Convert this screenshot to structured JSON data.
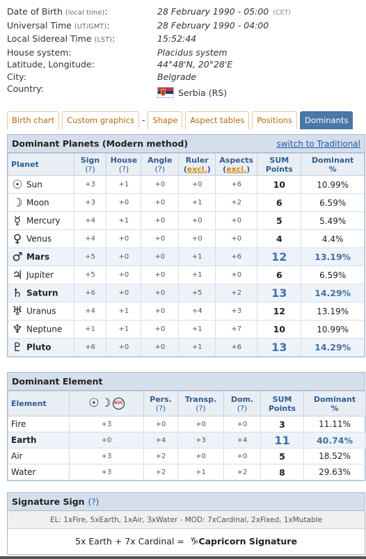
{
  "info": [
    {
      "label": "Date of Birth",
      "hint": "(local time)",
      "value": "28 February 1990 - 05:00",
      "extra": "(CET)"
    },
    {
      "label": "Universal Time",
      "hint": "(UT/GMT)",
      "value": "28 February 1990 - 04:00",
      "extra": ""
    },
    {
      "label": "Local Sidereal Time",
      "hint": "(LST)",
      "value": "15:52:44",
      "extra": ""
    },
    {
      "label": "House system:",
      "hint": "",
      "value": "Placidus system",
      "extra": ""
    },
    {
      "label": "Latitude, Longitude:",
      "hint": "",
      "value": "44°48'N, 20°28'E",
      "extra": ""
    },
    {
      "label": "City:",
      "hint": "",
      "value": "Belgrade",
      "extra": ""
    },
    {
      "label": "Country:",
      "hint": "",
      "value": "Serbia (RS)",
      "extra": ""
    }
  ],
  "tabs": [
    "Birth chart",
    "Custom graphics",
    "-",
    "Shape",
    "Aspect tables",
    "Positions",
    "Dominants"
  ],
  "active_tab": "Dominants",
  "planets_box": {
    "title": "Dominant Planets (Modern method)",
    "link": "switch to Traditional",
    "headers": {
      "planet": "Planet",
      "sign": "Sign",
      "house": "House",
      "angle": "Angle",
      "ruler": "Ruler",
      "aspects": "Aspects",
      "q": "(?)",
      "excl": "excl.",
      "sum1": "SUM",
      "sum2": "Points",
      "dom1": "Dominant",
      "dom2": "%"
    },
    "rows": [
      {
        "icon": "sun-icon",
        "glyph": "☉",
        "name": "Sun",
        "sign": "+3",
        "house": "+1",
        "angle": "+0",
        "ruler": "+0",
        "aspects": "+6",
        "sum": "10",
        "dom": "10.99%",
        "hl": false
      },
      {
        "icon": "moon-icon",
        "glyph": "☽",
        "name": "Moon",
        "sign": "+3",
        "house": "+0",
        "angle": "+0",
        "ruler": "+1",
        "aspects": "+2",
        "sum": "6",
        "dom": "6.59%",
        "hl": false
      },
      {
        "icon": "mercury-icon",
        "glyph": "☿",
        "name": "Mercury",
        "sign": "+4",
        "house": "+1",
        "angle": "+0",
        "ruler": "+0",
        "aspects": "+0",
        "sum": "5",
        "dom": "5.49%",
        "hl": false
      },
      {
        "icon": "venus-icon",
        "glyph": "♀",
        "name": "Venus",
        "sign": "+4",
        "house": "+0",
        "angle": "+0",
        "ruler": "+0",
        "aspects": "+0",
        "sum": "4",
        "dom": "4.4%",
        "hl": false
      },
      {
        "icon": "mars-icon",
        "glyph": "♂",
        "name": "Mars",
        "sign": "+5",
        "house": "+0",
        "angle": "+0",
        "ruler": "+1",
        "aspects": "+6",
        "sum": "12",
        "dom": "13.19%",
        "hl": true
      },
      {
        "icon": "jupiter-icon",
        "glyph": "♃",
        "name": "Jupiter",
        "sign": "+5",
        "house": "+0",
        "angle": "+0",
        "ruler": "+1",
        "aspects": "+0",
        "sum": "6",
        "dom": "6.59%",
        "hl": false
      },
      {
        "icon": "saturn-icon",
        "glyph": "♄",
        "name": "Saturn",
        "sign": "+6",
        "house": "+0",
        "angle": "+0",
        "ruler": "+5",
        "aspects": "+2",
        "sum": "13",
        "dom": "14.29%",
        "hl": true
      },
      {
        "icon": "uranus-icon",
        "glyph": "♅",
        "name": "Uranus",
        "sign": "+4",
        "house": "+1",
        "angle": "+0",
        "ruler": "+4",
        "aspects": "+3",
        "sum": "12",
        "dom": "13.19%",
        "hl": false
      },
      {
        "icon": "neptune-icon",
        "glyph": "♆",
        "name": "Neptune",
        "sign": "+1",
        "house": "+1",
        "angle": "+0",
        "ruler": "+1",
        "aspects": "+7",
        "sum": "10",
        "dom": "10.99%",
        "hl": false
      },
      {
        "icon": "pluto-icon",
        "glyph": "♇",
        "name": "Pluto",
        "sign": "+6",
        "house": "+0",
        "angle": "+0",
        "ruler": "+1",
        "aspects": "+6",
        "sum": "13",
        "dom": "14.29%",
        "hl": true
      }
    ]
  },
  "element_box": {
    "title": "Dominant Element",
    "headers": {
      "element": "Element",
      "pers": "Pers.",
      "transp": "Transp.",
      "dom_short": "Dom.",
      "q": "(?)",
      "sum1": "SUM",
      "sum2": "Points",
      "dom1": "Dominant",
      "dom2": "%",
      "asc": "ASC"
    },
    "rows": [
      {
        "name": "Fire",
        "scm": "+3",
        "pers": "+0",
        "transp": "+0",
        "dom_pts": "+0",
        "sum": "3",
        "dom": "11.11%",
        "hl": false
      },
      {
        "name": "Earth",
        "scm": "+0",
        "pers": "+4",
        "transp": "+3",
        "dom_pts": "+4",
        "sum": "11",
        "dom": "40.74%",
        "hl": true
      },
      {
        "name": "Air",
        "scm": "+3",
        "pers": "+2",
        "transp": "+0",
        "dom_pts": "+0",
        "sum": "5",
        "dom": "18.52%",
        "hl": false
      },
      {
        "name": "Water",
        "scm": "+3",
        "pers": "+2",
        "transp": "+1",
        "dom_pts": "+2",
        "sum": "8",
        "dom": "29.63%",
        "hl": false
      }
    ]
  },
  "signature_box": {
    "title": "Signature Sign",
    "q": "(?)",
    "summary": "EL: 1xFire, 5xEarth, 1xAir, 3xWater -  MOD: 7xCardinal, 2xFixed, 1xMutable",
    "formula": "5x Earth + 7x Cardinal =",
    "capricorn_glyph": "♑",
    "result": "Capricorn Signature"
  }
}
